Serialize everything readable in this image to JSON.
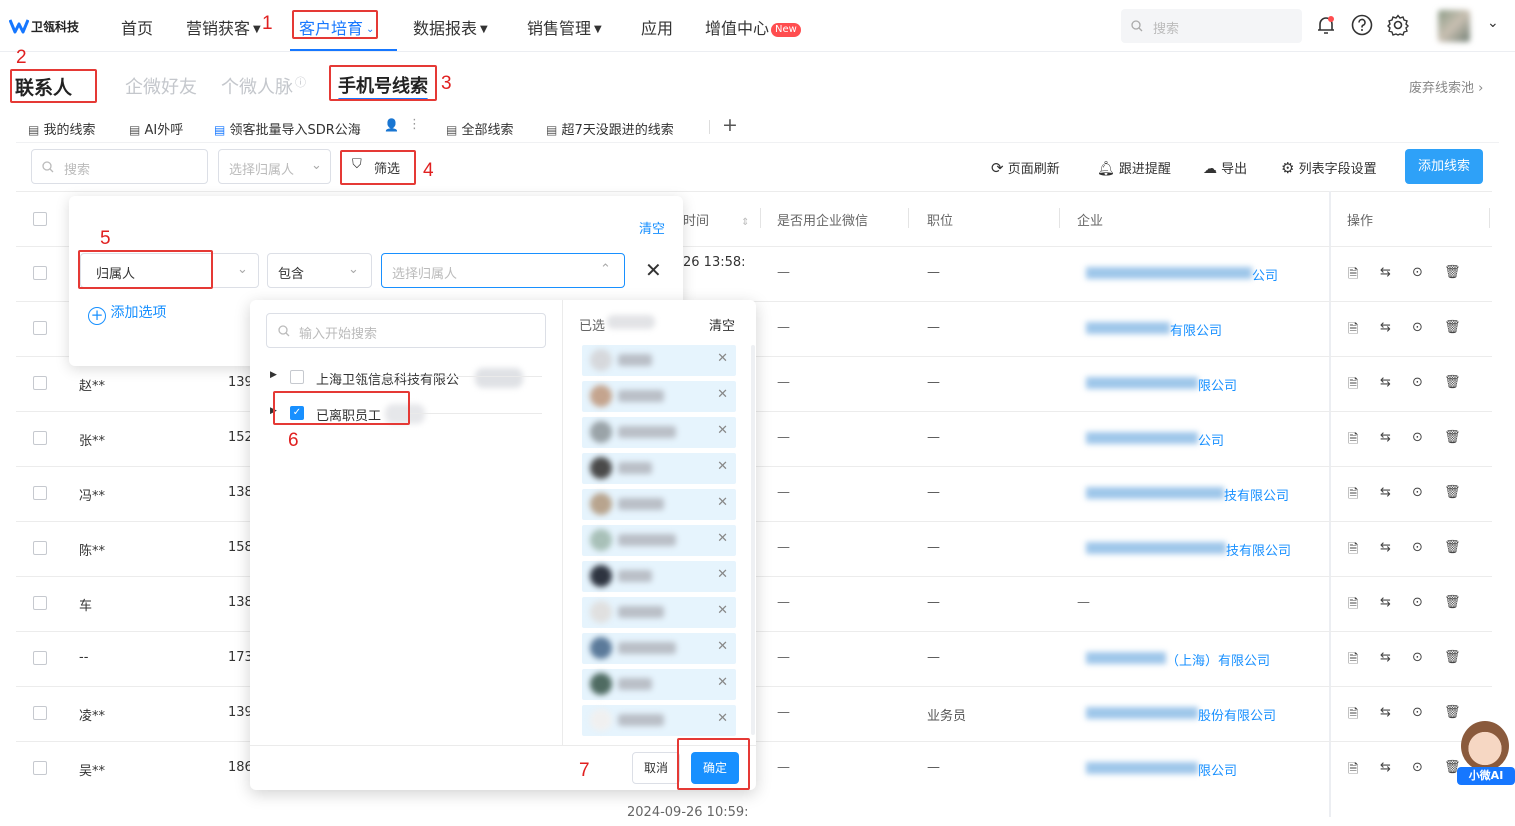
{
  "header": {
    "logo_text": "卫瓴科技",
    "nav": [
      {
        "label": "首页"
      },
      {
        "label": "营销获客"
      },
      {
        "label": "客户培育"
      },
      {
        "label": "数据报表"
      },
      {
        "label": "销售管理"
      },
      {
        "label": "应用"
      },
      {
        "label": "增值中心"
      }
    ],
    "new_badge": "New",
    "search_placeholder": "搜索"
  },
  "annotations": [
    "1",
    "2",
    "3",
    "4",
    "5",
    "6",
    "7"
  ],
  "subtabs": {
    "items": [
      "联系人",
      "企微好友",
      "个微人脉",
      "手机号线索"
    ],
    "waste_pool": "废弃线索池"
  },
  "viewtabs": [
    "我的线索",
    "AI外呼",
    "领客批量导入SDR公海",
    "全部线索",
    "超7天没跟进的线索"
  ],
  "toolbar": {
    "search_placeholder": "搜索",
    "owner_placeholder": "选择归属人",
    "filter_label": "筛选",
    "refresh": "页面刷新",
    "reminder": "跟进提醒",
    "export": "导出",
    "columns": "列表字段设置",
    "add_lead": "添加线索"
  },
  "table": {
    "headers": {
      "time": "时间",
      "wecom": "是否用企业微信",
      "position": "职位",
      "company": "企业",
      "action": "操作"
    },
    "rows": [
      {
        "name": "",
        "phone": "",
        "time": "26 13:58:",
        "wecom": "—",
        "position": "—",
        "company": "公司"
      },
      {
        "name": "",
        "phone": "",
        "time": "",
        "wecom": "—",
        "position": "—",
        "company": "有限公司"
      },
      {
        "name": "赵**",
        "phone": "139",
        "time": "",
        "wecom": "—",
        "position": "—",
        "company": "限公司"
      },
      {
        "name": "张**",
        "phone": "152",
        "time": "",
        "wecom": "—",
        "position": "—",
        "company": "公司"
      },
      {
        "name": "冯**",
        "phone": "138",
        "time": "",
        "wecom": "—",
        "position": "—",
        "company": "技有限公司"
      },
      {
        "name": "陈**",
        "phone": "158",
        "time": "",
        "wecom": "—",
        "position": "—",
        "company": "技有限公司"
      },
      {
        "name": "车",
        "phone": "138",
        "time": "",
        "wecom": "—",
        "position": "—",
        "company": "—"
      },
      {
        "name": "--",
        "phone": "173",
        "time": "",
        "wecom": "—",
        "position": "—",
        "company": "（上海）有限公司"
      },
      {
        "name": "凌**",
        "phone": "139",
        "time": "",
        "wecom": "—",
        "position": "业务员",
        "company": "股份有限公司"
      },
      {
        "name": "吴**",
        "phone": "186",
        "time": "",
        "wecom": "—",
        "position": "—",
        "company": "限公司"
      }
    ],
    "footer_time": "2024-09-26 10:59:"
  },
  "filter_panel": {
    "clear": "清空",
    "field": "归属人",
    "operator": "包含",
    "value_placeholder": "选择归属人",
    "add_option": "添加选项"
  },
  "picker": {
    "search_placeholder": "输入开始搜索",
    "tree": [
      {
        "label": "上海卫瓴信息科技有限公",
        "checked": false
      },
      {
        "label": "已离职员工",
        "checked": true
      }
    ],
    "selected_title": "已选",
    "selected_clear": "清空",
    "cancel": "取消",
    "confirm": "确定"
  },
  "assistant": {
    "label": "小微AI"
  },
  "colors": {
    "primary": "#1890ff",
    "accent": "#2ea1f8",
    "annotation": "#e53935"
  }
}
